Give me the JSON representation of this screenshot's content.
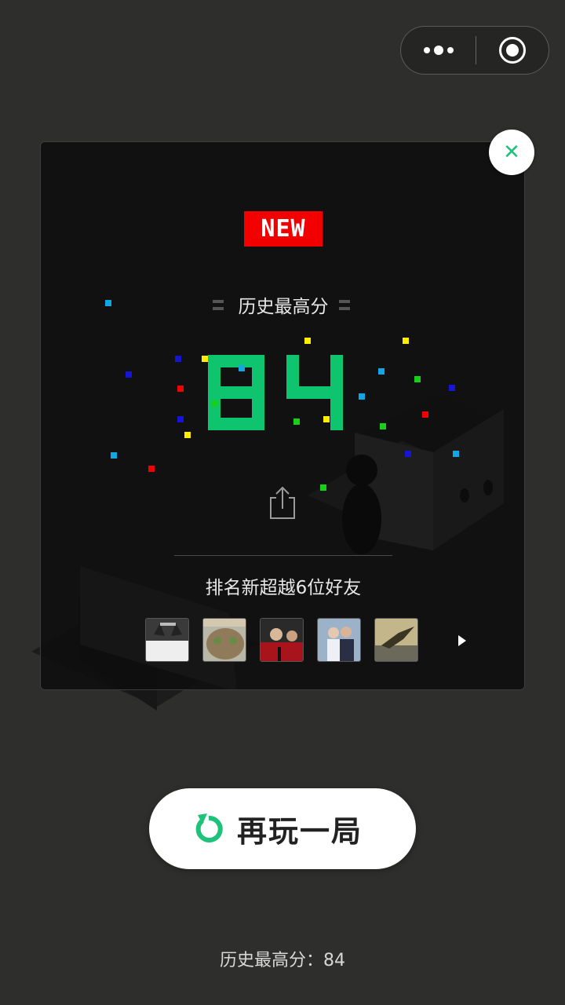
{
  "capsule": {
    "more_icon": "more-dots-icon",
    "close_icon": "target-circle-icon"
  },
  "panel": {
    "new_badge": "NEW",
    "best_label": "历史最高分",
    "score": "84",
    "score_color": "#0fc46f",
    "share_icon": "share-icon",
    "rank_text": "排名新超越6位好友",
    "friends": [
      {
        "avatar": "cat-avatar"
      },
      {
        "avatar": "kitten-avatar"
      },
      {
        "avatar": "football-avatar"
      },
      {
        "avatar": "couple-avatar"
      },
      {
        "avatar": "bird-avatar"
      }
    ],
    "next_icon": "play-right-icon",
    "close_icon": "close-icon"
  },
  "replay": {
    "label": "再玩一局",
    "icon": "replay-icon",
    "accent": "#1fc279"
  },
  "footer": {
    "best_text": "历史最高分：84"
  }
}
